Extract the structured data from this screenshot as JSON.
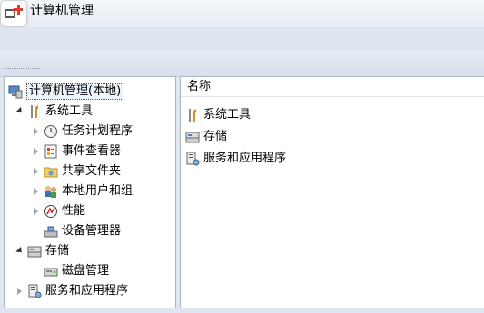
{
  "window": {
    "title": "计算机管理"
  },
  "tree": {
    "root": "计算机管理(本地)",
    "system_tools": "系统工具",
    "task_scheduler": "任务计划程序",
    "event_viewer": "事件查看器",
    "shared_folders": "共享文件夹",
    "local_users_groups": "本地用户和组",
    "performance": "性能",
    "device_manager": "设备管理器",
    "storage": "存储",
    "disk_management": "磁盘管理",
    "services_apps": "服务和应用程序"
  },
  "list": {
    "column_name": "名称",
    "items": [
      "系统工具",
      "存储",
      "服务和应用程序"
    ]
  }
}
